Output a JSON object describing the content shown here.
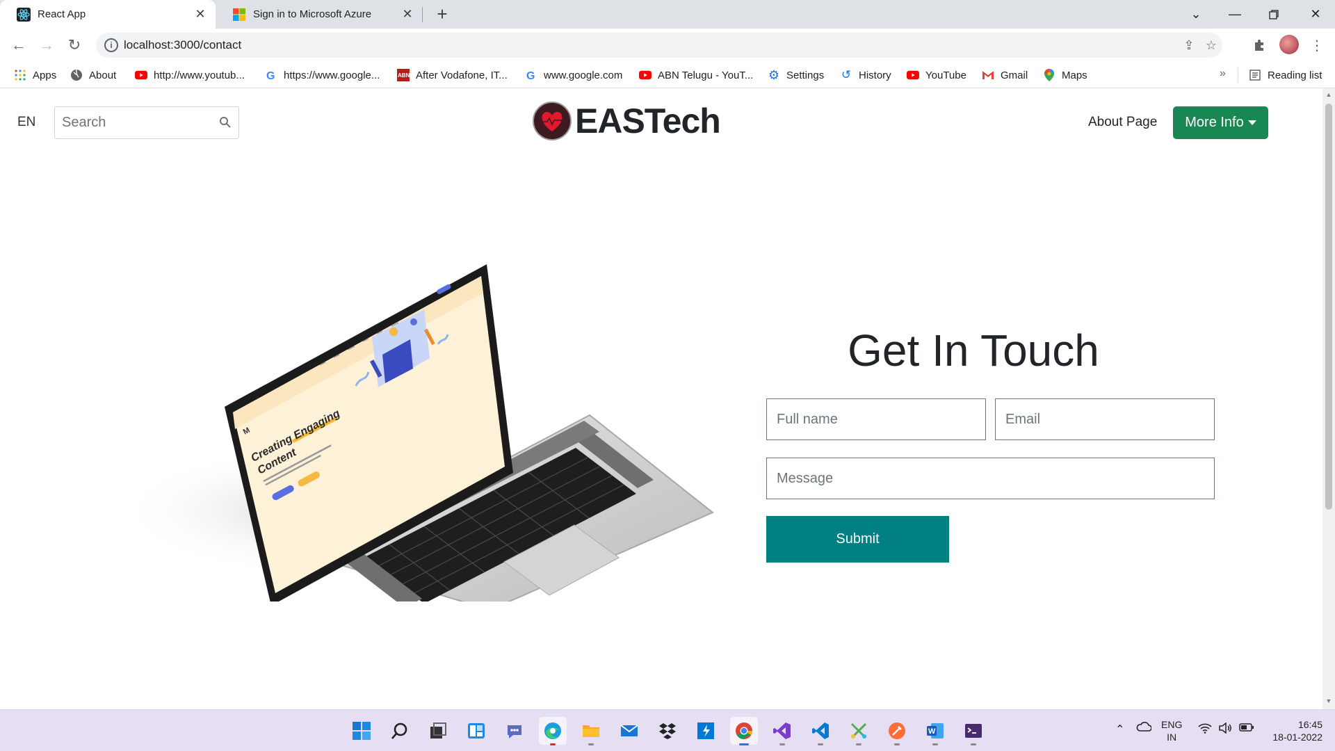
{
  "browser": {
    "tabs": [
      {
        "title": "React App",
        "active": true
      },
      {
        "title": "Sign in to Microsoft Azure",
        "active": false
      }
    ],
    "url": "localhost:3000/contact",
    "bookmarks": [
      {
        "label": "Apps",
        "icon": "apps-grid-icon"
      },
      {
        "label": "About",
        "icon": "globe-icon"
      },
      {
        "label": "http://www.youtub...",
        "icon": "youtube-icon"
      },
      {
        "label": "https://www.google...",
        "icon": "google-icon"
      },
      {
        "label": "After Vodafone, IT...",
        "icon": "news-icon"
      },
      {
        "label": "www.google.com",
        "icon": "google-icon"
      },
      {
        "label": "ABN Telugu - YouT...",
        "icon": "youtube-icon"
      },
      {
        "label": "Settings",
        "icon": "gear-icon"
      },
      {
        "label": "History",
        "icon": "history-icon"
      },
      {
        "label": "YouTube",
        "icon": "youtube-icon"
      },
      {
        "label": "Gmail",
        "icon": "gmail-icon"
      },
      {
        "label": "Maps",
        "icon": "maps-pin-icon"
      }
    ],
    "reading_list": "Reading list",
    "overflow": "»"
  },
  "navbar": {
    "lang": "EN",
    "search_placeholder": "Search",
    "brand": "EASTech",
    "about_link": "About Page",
    "more_button": "More Info"
  },
  "contact": {
    "title": "Get In Touch",
    "fullname_placeholder": "Full name",
    "email_placeholder": "Email",
    "message_placeholder": "Message",
    "submit_label": "Submit"
  },
  "illustration": {
    "headline_line1": "Creating Engaging",
    "headline_line2": "Content",
    "logo_letter": "M"
  },
  "taskbar": {
    "apps": [
      "start-icon",
      "search-icon",
      "task-view-icon",
      "widgets-icon",
      "teams-chat-icon",
      "edge-icon",
      "file-explorer-icon",
      "mail-icon",
      "dropbox-icon",
      "azure-devops-icon",
      "chrome-icon",
      "visual-studio-icon",
      "vscode-icon",
      "snip-tool-icon",
      "postman-icon",
      "word-icon",
      "terminal-icon"
    ],
    "lang_line1": "ENG",
    "lang_line2": "IN",
    "time": "16:45",
    "date": "18-01-2022"
  },
  "colors": {
    "more_button": "#198754",
    "submit_button": "#008080",
    "taskbar": "#e6dff3"
  }
}
